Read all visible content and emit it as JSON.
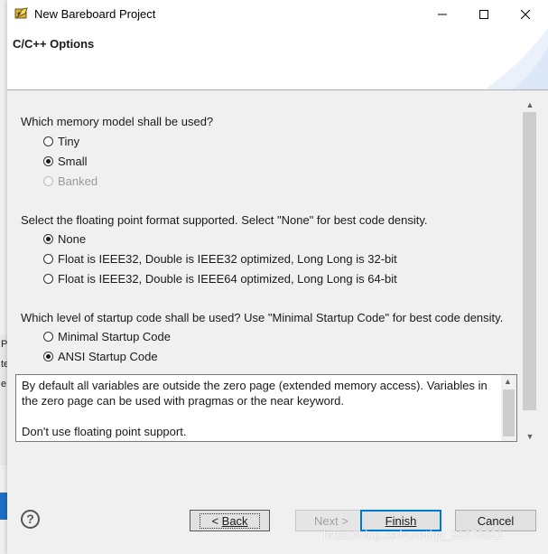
{
  "window": {
    "title": "New Bareboard Project",
    "controls": {
      "minimize": "minimize",
      "maximize": "maximize",
      "close": "close"
    }
  },
  "banner": {
    "title": "C/C++ Options"
  },
  "background": {
    "left_fragments": [
      "P",
      "te",
      "e"
    ]
  },
  "memory_model": {
    "question": "Which memory model shall be used?",
    "options": [
      {
        "label": "Tiny",
        "checked": false,
        "enabled": true
      },
      {
        "label": "Small",
        "checked": true,
        "enabled": true
      },
      {
        "label": "Banked",
        "checked": false,
        "enabled": false
      }
    ]
  },
  "floating_point": {
    "question": "Select the floating point format supported. Select \"None\" for best code density.",
    "options": [
      {
        "label": "None",
        "checked": true,
        "enabled": true
      },
      {
        "label": "Float is IEEE32, Double is IEEE32 optimized, Long Long is 32-bit",
        "checked": false,
        "enabled": true
      },
      {
        "label": "Float is IEEE32, Double is IEEE64 optimized, Long Long is 64-bit",
        "checked": false,
        "enabled": true
      }
    ]
  },
  "startup_code": {
    "question": "Which level of startup code shall be used? Use \"Minimal Startup Code\" for best code density.",
    "options": [
      {
        "label": "Minimal Startup Code",
        "checked": false,
        "enabled": true
      },
      {
        "label": "ANSI Startup Code",
        "checked": true,
        "enabled": true
      }
    ]
  },
  "description": {
    "para1": "By default all variables are outside the zero page (extended memory access). Variables in the zero page can be used with pragmas or the near keyword.",
    "para2": "Don't use floating point support."
  },
  "footer": {
    "help": "?",
    "back_prefix": "< ",
    "back_label": "Back",
    "next_label": "Next >",
    "finish_label": "Finish",
    "cancel_label": "Cancel",
    "watermark": "https://blog.csdn.net/qq_31676021"
  },
  "icons": {
    "app": "bareboard-project-icon",
    "help": "help-icon",
    "scroll_up": "scroll-up-icon",
    "scroll_down": "scroll-down-icon"
  },
  "colors": {
    "accent": "#0078d7",
    "dialog_bg": "#f0f0f0",
    "banner_bg": "#ffffff"
  }
}
